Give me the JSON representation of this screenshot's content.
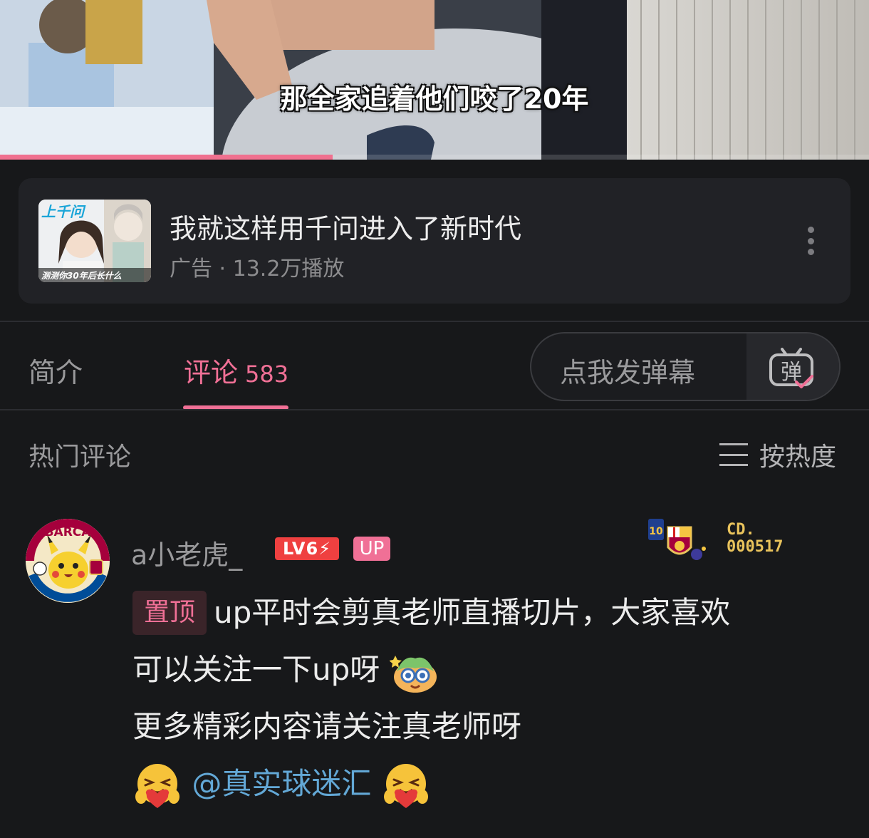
{
  "video": {
    "subtitle": "那全家追着他们咬了20年",
    "progress_fraction": 0.383
  },
  "ad": {
    "thumb_title": "上千问",
    "thumb_caption": "测测你30年后长什么",
    "title": "我就这样用千问进入了新时代",
    "meta": "广告 · 13.2万播放"
  },
  "tabs": {
    "intro": "简介",
    "comments": "评论",
    "comments_count": "583"
  },
  "danmaku": {
    "placeholder": "点我发弹幕",
    "icon_glyph": "弹"
  },
  "hot": {
    "title": "热门评论",
    "sort_label": "按热度"
  },
  "comment": {
    "username": "a小老虎_",
    "level": "LV6",
    "up_badge": "UP",
    "fan_badge_line1": "CD.",
    "fan_badge_line2": "000517",
    "avatar_text": "BARCA",
    "pin_label": "置顶",
    "line1": "up平时会剪真老师直播切片，大家喜欢",
    "line2": "可以关注一下up呀",
    "line3": "更多精彩内容请关注真老师呀",
    "mention": "@真实球迷汇"
  },
  "colors": {
    "accent": "#f07096",
    "mention": "#63a8d6",
    "level": "#ef4040",
    "background": "#17181a"
  }
}
